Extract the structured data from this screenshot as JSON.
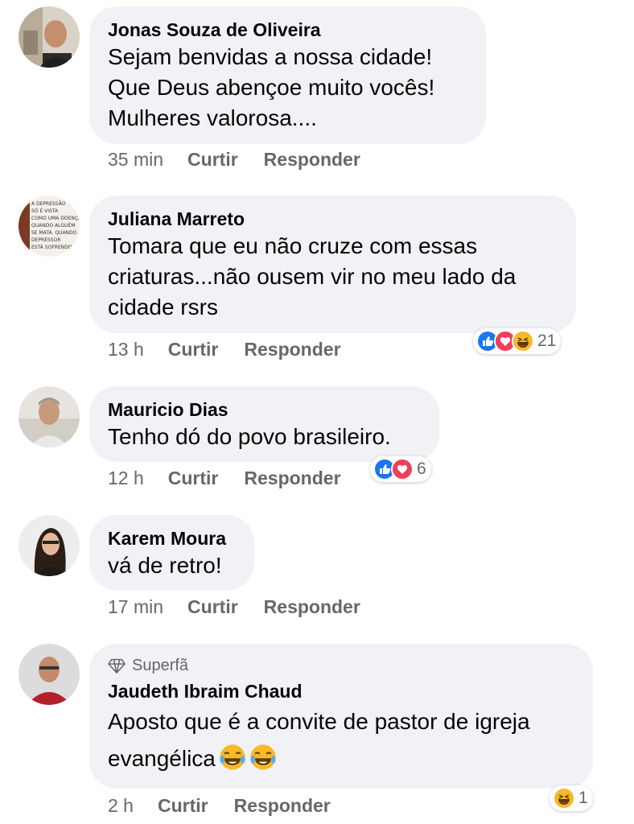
{
  "comments": [
    {
      "name": "Jonas Souza de Oliveira",
      "text": "Sejam benvidas a nossa cidade!\nQue Deus abençoe muito vocês!\nMulheres valorosa....",
      "time": "35 min",
      "like_label": "Curtir",
      "reply_label": "Responder"
    },
    {
      "name": "Juliana Marreto",
      "avatar_text": "A DEPRESSÃO SÓ É VISTA COMO UMA DOENÇA QUANDO ALGUÉM SE MATA. QUANDO DEPRESSOR ESTÁ SOFRENDO É SÓ FRESCURA",
      "text": "Tomara que eu não cruze com essas\ncriaturas...não ousem vir no meu lado da\ncidade rsrs",
      "time": "13 h",
      "like_label": "Curtir",
      "reply_label": "Responder",
      "reactions": [
        "like-icon",
        "love-icon",
        "haha-icon"
      ],
      "reaction_count": "21"
    },
    {
      "name": "Mauricio Dias",
      "text": "Tenho dó do povo brasileiro.",
      "time": "12 h",
      "like_label": "Curtir",
      "reply_label": "Responder",
      "reactions": [
        "like-icon",
        "love-icon"
      ],
      "reaction_count": "6"
    },
    {
      "name": "Karem Moura",
      "text": "vá de retro!",
      "time": "17 min",
      "like_label": "Curtir",
      "reply_label": "Responder"
    },
    {
      "badge": "Superfã",
      "name": "Jaudeth Ibraim Chaud",
      "text": "Aposto que é a convite de pastor de igreja\nevangélica",
      "text_emojis": [
        "tears-of-joy-icon",
        "tears-of-joy-icon"
      ],
      "time": "2 h",
      "like_label": "Curtir",
      "reply_label": "Responder",
      "reactions": [
        "haha-icon"
      ],
      "reaction_count": "1"
    }
  ],
  "colors": {
    "bubble": "#f0f2f5",
    "meta_text": "#65676b",
    "like_blue": "#1877f2",
    "love_red": "#f33e58",
    "haha_yellow": "#f7b928"
  }
}
